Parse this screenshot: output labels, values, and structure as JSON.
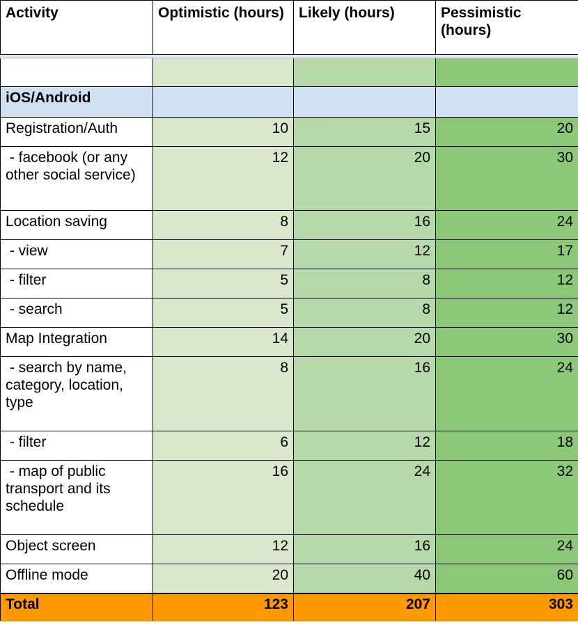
{
  "table": {
    "columns": [
      {
        "key": "activity",
        "label": "Activity"
      },
      {
        "key": "optimistic",
        "label": "Optimistic (hours)"
      },
      {
        "key": "likely",
        "label": "Likely (hours)"
      },
      {
        "key": "pessimistic",
        "label": "Pessimistic (hours)"
      }
    ],
    "band_row": {
      "activity": "",
      "optimistic": "",
      "likely": "",
      "pessimistic": ""
    },
    "section": {
      "label": "iOS/Android",
      "optimistic": "",
      "likely": "",
      "pessimistic": ""
    },
    "rows": [
      {
        "activity": "Registration/Auth",
        "optimistic": "10",
        "likely": "15",
        "pessimistic": "20",
        "lines": 1
      },
      {
        "activity": " - facebook (or any other social service)",
        "optimistic": "12",
        "likely": "20",
        "pessimistic": "30",
        "lines": 4
      },
      {
        "activity": "Location saving",
        "optimistic": "8",
        "likely": "16",
        "pessimistic": "24",
        "lines": 1
      },
      {
        "activity": " - view",
        "optimistic": "7",
        "likely": "12",
        "pessimistic": "17",
        "lines": 1
      },
      {
        "activity": " - filter",
        "optimistic": "5",
        "likely": "8",
        "pessimistic": "12",
        "lines": 1
      },
      {
        "activity": " - search",
        "optimistic": "5",
        "likely": "8",
        "pessimistic": "12",
        "lines": 1
      },
      {
        "activity": "Map Integration",
        "optimistic": "14",
        "likely": "20",
        "pessimistic": "30",
        "lines": 1
      },
      {
        "activity": " - search by name, category, location, type",
        "optimistic": "8",
        "likely": "16",
        "pessimistic": "24",
        "lines": 3
      },
      {
        "activity": " - filter",
        "optimistic": "6",
        "likely": "12",
        "pessimistic": "18",
        "lines": 1
      },
      {
        "activity": " - map of public transport and its schedule",
        "optimistic": "16",
        "likely": "24",
        "pessimistic": "32",
        "lines": 3
      },
      {
        "activity": "Object screen",
        "optimistic": "12",
        "likely": "16",
        "pessimistic": "24",
        "lines": 1
      },
      {
        "activity": "Offline mode",
        "optimistic": "20",
        "likely": "40",
        "pessimistic": "60",
        "lines": 1
      }
    ],
    "total": {
      "label": "Total",
      "optimistic": "123",
      "likely": "207",
      "pessimistic": "303"
    }
  },
  "colors": {
    "optimistic_fill": "#d9e8cd",
    "likely_fill": "#b7d8a8",
    "pessimistic_fill": "#8cc878",
    "section_fill": "#cfe0f0",
    "total_fill": "#ff9900",
    "grid_line": "#000000",
    "spacer_fill": "#dfe5ee"
  }
}
